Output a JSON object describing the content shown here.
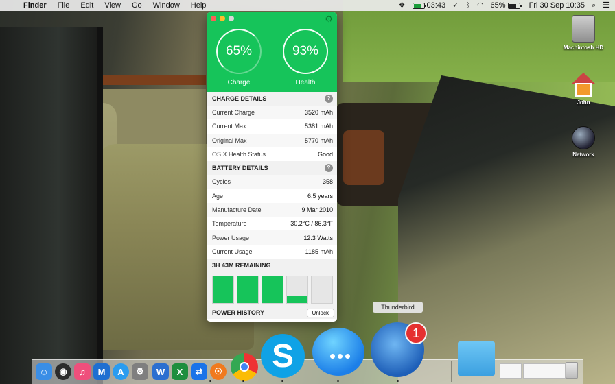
{
  "menubar": {
    "apple_icon": "apple-icon",
    "app_name": "Finder",
    "menus": [
      "File",
      "Edit",
      "View",
      "Go",
      "Window",
      "Help"
    ],
    "battery_time": "03:43",
    "wifi_icon": "wifi-icon",
    "battery_percent": "65%",
    "datetime": "Fri 30 Sep  10:35"
  },
  "desktop": {
    "icons": [
      {
        "label": "Machintosh HD",
        "icon": "hard-drive-icon"
      },
      {
        "label": "John",
        "icon": "home-folder-icon"
      },
      {
        "label": "Network",
        "icon": "network-globe-icon"
      }
    ]
  },
  "battery": {
    "accent_color": "#16c45a",
    "charge_percent": "65%",
    "charge_label": "Charge",
    "health_percent": "93%",
    "health_label": "Health",
    "charge_details": {
      "title": "CHARGE DETAILS",
      "rows": [
        {
          "label": "Current Charge",
          "value": "3520 mAh"
        },
        {
          "label": "Current Max",
          "value": "5381 mAh"
        },
        {
          "label": "Original Max",
          "value": "5770 mAh"
        },
        {
          "label": "OS X Health Status",
          "value": "Good"
        }
      ]
    },
    "battery_details": {
      "title": "BATTERY DETAILS",
      "rows": [
        {
          "label": "Cycles",
          "value": "358"
        },
        {
          "label": "Age",
          "value": "6.5 years"
        },
        {
          "label": "Manufacture Date",
          "value": "9 Mar 2010"
        },
        {
          "label": "Temperature",
          "value": "30.2°C / 86.3°F"
        },
        {
          "label": "Power Usage",
          "value": "12.3 Watts"
        },
        {
          "label": "Current Usage",
          "value": "1185 mAh"
        }
      ]
    },
    "remaining": "3H 43M REMAINING",
    "level_bars": [
      1,
      1,
      1,
      0.25,
      0
    ],
    "power_history_label": "POWER HISTORY",
    "unlock_label": "Unlock"
  },
  "dock": {
    "tooltip": "Thunderbird",
    "thunderbird_badge": "1",
    "apps": [
      "finder-icon",
      "dashboard-icon",
      "itunes-icon",
      "maps-icon",
      "app-store-icon",
      "system-preferences-icon",
      "word-icon",
      "excel-icon",
      "teamviewer-icon",
      "firefox-icon",
      "chrome-icon",
      "skype-icon",
      "messages-icon",
      "thunderbird-icon"
    ]
  }
}
